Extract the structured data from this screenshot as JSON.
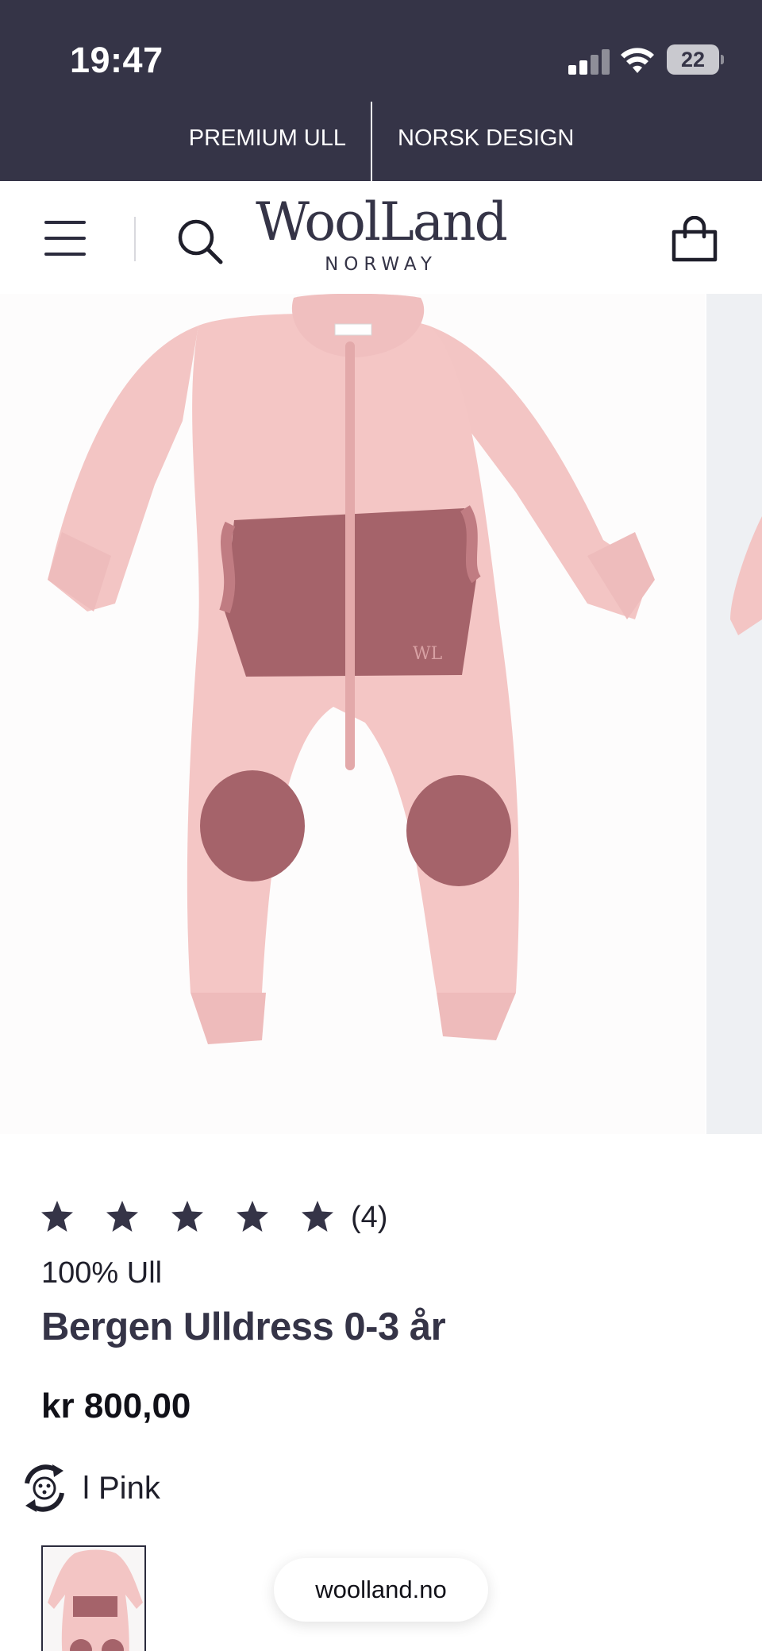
{
  "status_bar": {
    "time": "19:47",
    "battery": "22",
    "signal_icon": "cellular-signal-icon",
    "wifi_icon": "wifi-icon"
  },
  "promo_bar": {
    "left": "PREMIUM ULL",
    "right": "NORSK DESIGN"
  },
  "header": {
    "logo_main": "WoolLand",
    "logo_sub": "NORWAY",
    "menu_icon": "hamburger-menu-icon",
    "search_icon": "search-icon",
    "cart_icon": "shopping-bag-icon"
  },
  "product": {
    "rating": 5,
    "rating_max": 5,
    "review_count": "(4)",
    "material": "100% Ull",
    "title": "Bergen Ulldress 0-3 år",
    "price": "kr 800,00",
    "color_label": "l Pink"
  },
  "browser": {
    "url": "woolland.no"
  },
  "colors": {
    "brand_dark": "#353447",
    "garment_pink": "#f2c4c4",
    "patch_mauve": "#a5636a"
  }
}
